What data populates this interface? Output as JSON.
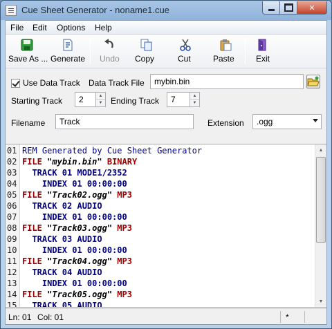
{
  "window": {
    "title": "Cue Sheet Generator - noname1.cue"
  },
  "menu": [
    "File",
    "Edit",
    "Options",
    "Help"
  ],
  "toolbar": {
    "save_as": "Save As ...",
    "generate": "Generate",
    "undo": "Undo",
    "copy": "Copy",
    "cut": "Cut",
    "paste": "Paste",
    "exit": "Exit"
  },
  "form": {
    "use_data_track_label": "Use Data Track",
    "use_data_track_checked": true,
    "data_track_file_label": "Data Track File",
    "data_track_file_value": "mybin.bin",
    "starting_track_label": "Starting Track",
    "starting_track_value": "2",
    "ending_track_label": "Ending Track",
    "ending_track_value": "7",
    "filename_label": "Filename",
    "filename_value": "Track",
    "extension_label": "Extension",
    "extension_value": ".ogg"
  },
  "editor": {
    "lines": [
      {
        "n": "01",
        "kind": "comment",
        "indent": "",
        "parts": [
          "REM Generated by Cue Sheet Generator"
        ]
      },
      {
        "n": "02",
        "kind": "file",
        "indent": "",
        "parts": [
          "FILE",
          "\"mybin.bin\"",
          "BINARY"
        ]
      },
      {
        "n": "03",
        "kind": "track",
        "indent": "  ",
        "parts": [
          "TRACK 01 MODE1/2352"
        ]
      },
      {
        "n": "04",
        "kind": "index",
        "indent": "    ",
        "parts": [
          "INDEX 01 00:00:00"
        ]
      },
      {
        "n": "05",
        "kind": "file",
        "indent": "",
        "parts": [
          "FILE",
          "\"Track02.ogg\"",
          "MP3"
        ]
      },
      {
        "n": "06",
        "kind": "track",
        "indent": "  ",
        "parts": [
          "TRACK 02 AUDIO"
        ]
      },
      {
        "n": "07",
        "kind": "index",
        "indent": "    ",
        "parts": [
          "INDEX 01 00:00:00"
        ]
      },
      {
        "n": "08",
        "kind": "file",
        "indent": "",
        "parts": [
          "FILE",
          "\"Track03.ogg\"",
          "MP3"
        ]
      },
      {
        "n": "09",
        "kind": "track",
        "indent": "  ",
        "parts": [
          "TRACK 03 AUDIO"
        ]
      },
      {
        "n": "10",
        "kind": "index",
        "indent": "    ",
        "parts": [
          "INDEX 01 00:00:00"
        ]
      },
      {
        "n": "11",
        "kind": "file",
        "indent": "",
        "parts": [
          "FILE",
          "\"Track04.ogg\"",
          "MP3"
        ]
      },
      {
        "n": "12",
        "kind": "track",
        "indent": "  ",
        "parts": [
          "TRACK 04 AUDIO"
        ]
      },
      {
        "n": "13",
        "kind": "index",
        "indent": "    ",
        "parts": [
          "INDEX 01 00:00:00"
        ]
      },
      {
        "n": "14",
        "kind": "file",
        "indent": "",
        "parts": [
          "FILE",
          "\"Track05.ogg\"",
          "MP3"
        ]
      },
      {
        "n": "15",
        "kind": "track",
        "indent": "  ",
        "parts": [
          "TRACK 05 AUDIO"
        ]
      }
    ]
  },
  "status": {
    "ln": "Ln: 01",
    "col": "Col: 01",
    "modified": "*"
  },
  "colors": {
    "keyword_red": "#a00000",
    "comment_blue": "#00008b",
    "titlebar": "#a9c6e6"
  }
}
